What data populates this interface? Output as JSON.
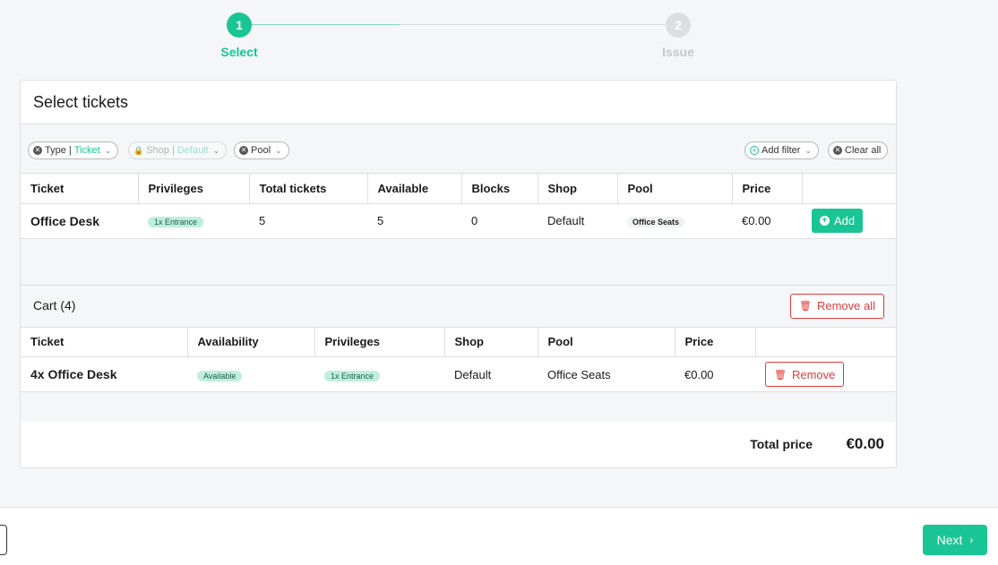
{
  "colors": {
    "accent": "#19c594",
    "danger": "#e03b3b"
  },
  "stepper": {
    "steps": [
      {
        "number": "1",
        "label": "Select",
        "state": "active"
      },
      {
        "number": "2",
        "label": "Issue",
        "state": "inactive"
      }
    ]
  },
  "card": {
    "title": "Select tickets"
  },
  "filters": {
    "type": {
      "key": "Type | ",
      "value": "Ticket"
    },
    "shop": {
      "key": "Shop | ",
      "value": "Default"
    },
    "pool": {
      "label": "Pool"
    },
    "add_filter": "Add filter",
    "clear_all": "Clear all"
  },
  "tickets": {
    "columns": [
      "Ticket",
      "Privileges",
      "Total tickets",
      "Available",
      "Blocks",
      "Shop",
      "Pool",
      "Price"
    ],
    "rows": [
      {
        "ticket": "Office Desk",
        "privileges": "1x Entrance",
        "total": "5",
        "available": "5",
        "blocks": "0",
        "shop": "Default",
        "pool": "Office Seats",
        "price": "€0.00",
        "action": "Add"
      }
    ]
  },
  "cart": {
    "title": "Cart (4)",
    "remove_all": "Remove all",
    "columns": [
      "Ticket",
      "Availability",
      "Privileges",
      "Shop",
      "Pool",
      "Price"
    ],
    "rows": [
      {
        "ticket": "4x Office Desk",
        "availability": "Available",
        "privileges": "1x Entrance",
        "shop": "Default",
        "pool": "Office Seats",
        "price": "€0.00",
        "action": "Remove"
      }
    ],
    "total_label": "Total price",
    "total_value": "€0.00"
  },
  "footer": {
    "next_label": "Next"
  },
  "icons": {
    "remove_filter": "close-circle-icon",
    "dropdown": "chevron-down-icon",
    "lock": "lock-icon",
    "add": "plus-circle-icon",
    "trash": "trash-icon",
    "next": "chevron-right-icon"
  }
}
